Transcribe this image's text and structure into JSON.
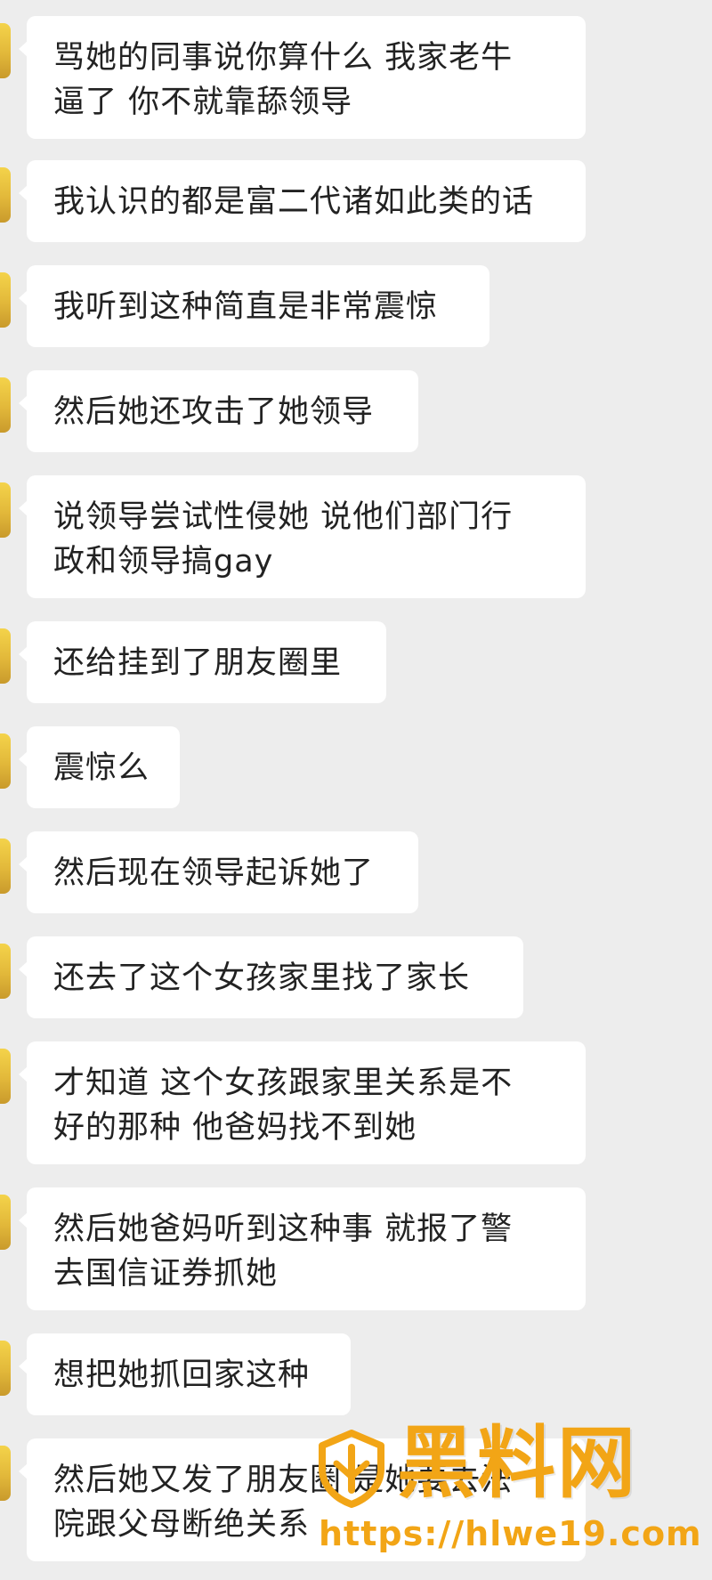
{
  "messages": [
    {
      "text": "骂她的同事说你算什么 我家老牛\n逼了 你不就靠舔领导"
    },
    {
      "text": "我认识的都是富二代诸如此类的话"
    },
    {
      "text": "我听到这种简直是非常震惊"
    },
    {
      "text": "然后她还攻击了她领导"
    },
    {
      "text": "说领导尝试性侵她 说他们部门行\n政和领导搞gay"
    },
    {
      "text": "还给挂到了朋友圈里"
    },
    {
      "text": "震惊么"
    },
    {
      "text": "然后现在领导起诉她了"
    },
    {
      "text": "还去了这个女孩家里找了家长"
    },
    {
      "text": "才知道 这个女孩跟家里关系是不\n好的那种 他爸妈找不到她"
    },
    {
      "text": "然后她爸妈听到这种事 就报了警\n去国信证券抓她"
    },
    {
      "text": "想把她抓回家这种"
    },
    {
      "text": "然后她又发了朋友圈 是她要去法\n院跟父母断绝关系"
    }
  ],
  "watermark": {
    "title": "黑料网",
    "url": "https://hlwe19.com",
    "logo_icon": "shield-logo-icon",
    "color": "#f2a516"
  },
  "colors": {
    "background": "#ededed",
    "bubble": "#ffffff",
    "text": "#222222",
    "avatar": "#f4d34a"
  }
}
